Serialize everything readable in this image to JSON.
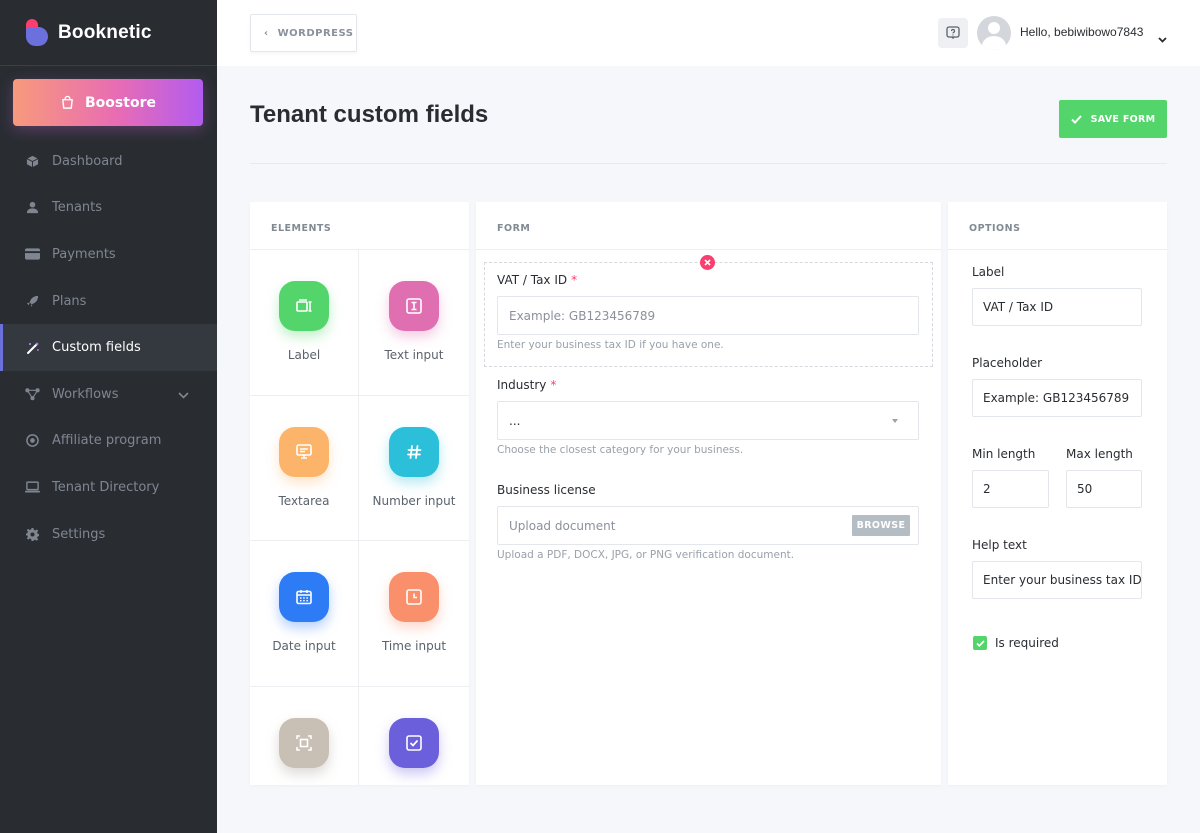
{
  "brand": {
    "name": "Booknetic"
  },
  "sidebar": {
    "boostore_label": "Boostore",
    "items": [
      {
        "label": "Dashboard",
        "icon": "cube-icon"
      },
      {
        "label": "Tenants",
        "icon": "user-icon"
      },
      {
        "label": "Payments",
        "icon": "credit-card-icon"
      },
      {
        "label": "Plans",
        "icon": "rocket-icon"
      },
      {
        "label": "Custom fields",
        "icon": "magic-wand-icon",
        "active": true
      },
      {
        "label": "Workflows",
        "icon": "workflow-icon",
        "has_submenu": true
      },
      {
        "label": "Affiliate program",
        "icon": "target-icon"
      },
      {
        "label": "Tenant Directory",
        "icon": "laptop-icon"
      },
      {
        "label": "Settings",
        "icon": "gear-icon"
      }
    ]
  },
  "header": {
    "back_label": "WORDPRESS",
    "greeting": "Hello, bebiwibowo7843"
  },
  "page": {
    "title": "Tenant custom fields",
    "save_label": "SAVE FORM"
  },
  "elements_panel": {
    "heading": "ELEMENTS",
    "items": [
      {
        "label": "Label",
        "icon": "label-icon",
        "color": "#53d56c"
      },
      {
        "label": "Text input",
        "icon": "text-cursor-icon",
        "color": "#e06fb2"
      },
      {
        "label": "Textarea",
        "icon": "monitor-icon",
        "color": "#fcb46b"
      },
      {
        "label": "Number input",
        "icon": "hash-icon",
        "color": "#2bbfd9"
      },
      {
        "label": "Date input",
        "icon": "calendar-icon",
        "color": "#2d7cf5"
      },
      {
        "label": "Time input",
        "icon": "clock-icon",
        "color": "#fa8f6c"
      },
      {
        "label": "",
        "icon": "frame-icon",
        "color": "#c9c0b5"
      },
      {
        "label": "",
        "icon": "checkbox-icon",
        "color": "#6c5fdc"
      }
    ]
  },
  "form_panel": {
    "heading": "FORM",
    "fields": [
      {
        "label": "VAT / Tax ID",
        "required": "*",
        "placeholder": "Example: GB123456789",
        "help": "Enter your business tax ID if you have one."
      },
      {
        "label": "Industry",
        "required": "*",
        "value": "...",
        "help": "Choose the closest category for your business."
      },
      {
        "label": "Business license",
        "placeholder": "Upload document",
        "button": "BROWSE",
        "help": "Upload a PDF, DOCX, JPG, or PNG verification document."
      }
    ]
  },
  "options_panel": {
    "heading": "OPTIONS",
    "label_title": "Label",
    "label_value": "VAT / Tax ID",
    "placeholder_title": "Placeholder",
    "placeholder_value": "Example: GB123456789",
    "min_title": "Min length",
    "min_value": "2",
    "max_title": "Max length",
    "max_value": "50",
    "help_title": "Help text",
    "help_value": "Enter your business tax ID",
    "required_label": "Is required",
    "required_checked": true
  }
}
